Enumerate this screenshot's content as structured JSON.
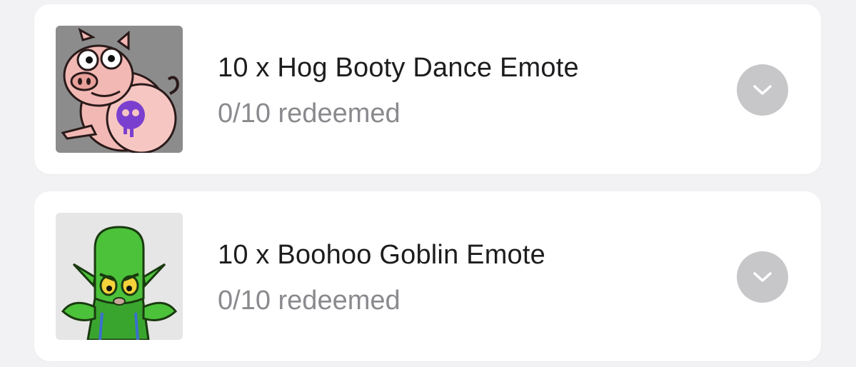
{
  "rewards": [
    {
      "title": "10 x Hog Booty Dance Emote",
      "status": "0/10 redeemed",
      "thumbnail_icon": "hog-booty-dance-emote-icon",
      "thumbnail_bg": "#8c8c8c"
    },
    {
      "title": "10 x Boohoo Goblin Emote",
      "status": "0/10 redeemed",
      "thumbnail_icon": "boohoo-goblin-emote-icon",
      "thumbnail_bg": "#e6e6e6"
    }
  ],
  "colors": {
    "page_bg": "#f2f2f4",
    "card_bg": "#ffffff",
    "title": "#1d1d1f",
    "subtitle": "#8a8a8e",
    "chevron_bg": "#c7c7c9",
    "pig_pink": "#f2b8b4",
    "goblin_green": "#4cc23a",
    "skull_purple": "#7b3fd0"
  }
}
